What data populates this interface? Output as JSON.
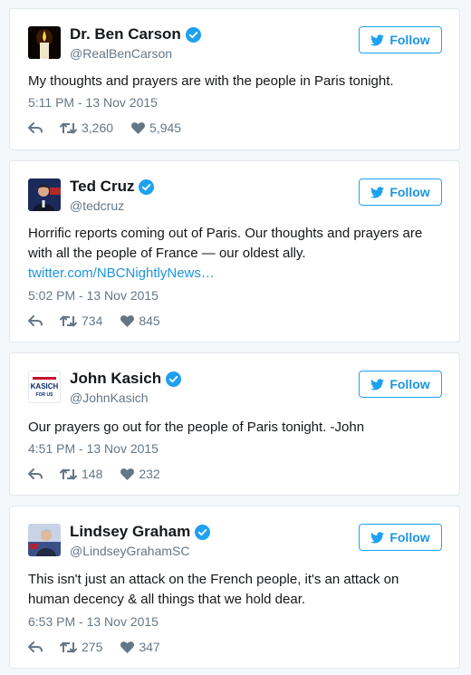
{
  "colors": {
    "accent": "#1da1f2",
    "meta": "#657786",
    "border": "#e1e8ed"
  },
  "follow_label": "Follow",
  "tweets": [
    {
      "name": "Dr. Ben Carson",
      "handle": "@RealBenCarson",
      "text": "My thoughts and prayers are with the people in Paris tonight.",
      "timestamp": "5:11 PM - 13 Nov 2015",
      "retweets": "3,260",
      "likes": "5,945",
      "avatar_icon": "candle-avatar"
    },
    {
      "name": "Ted Cruz",
      "handle": "@tedcruz",
      "text": "Horrific reports coming out of Paris. Our thoughts and prayers are with all the people of France — our oldest ally.",
      "link": "twitter.com/NBCNightlyNews…",
      "timestamp": "5:02 PM - 13 Nov 2015",
      "retweets": "734",
      "likes": "845",
      "avatar_icon": "portrait-avatar"
    },
    {
      "name": "John Kasich",
      "handle": "@JohnKasich",
      "text": "Our prayers go out for the people of Paris tonight. -John",
      "timestamp": "4:51 PM - 13 Nov 2015",
      "retweets": "148",
      "likes": "232",
      "avatar_icon": "kasich-logo-avatar",
      "avatar_logo": {
        "top": "KASICH",
        "bottom": "FOR US"
      }
    },
    {
      "name": "Lindsey Graham",
      "handle": "@LindseyGrahamSC",
      "text": "This isn't just an attack on the French people, it's an attack on human decency & all things that we hold dear.",
      "timestamp": "6:53 PM - 13 Nov 2015",
      "retweets": "275",
      "likes": "347",
      "avatar_icon": "portrait-avatar"
    }
  ]
}
